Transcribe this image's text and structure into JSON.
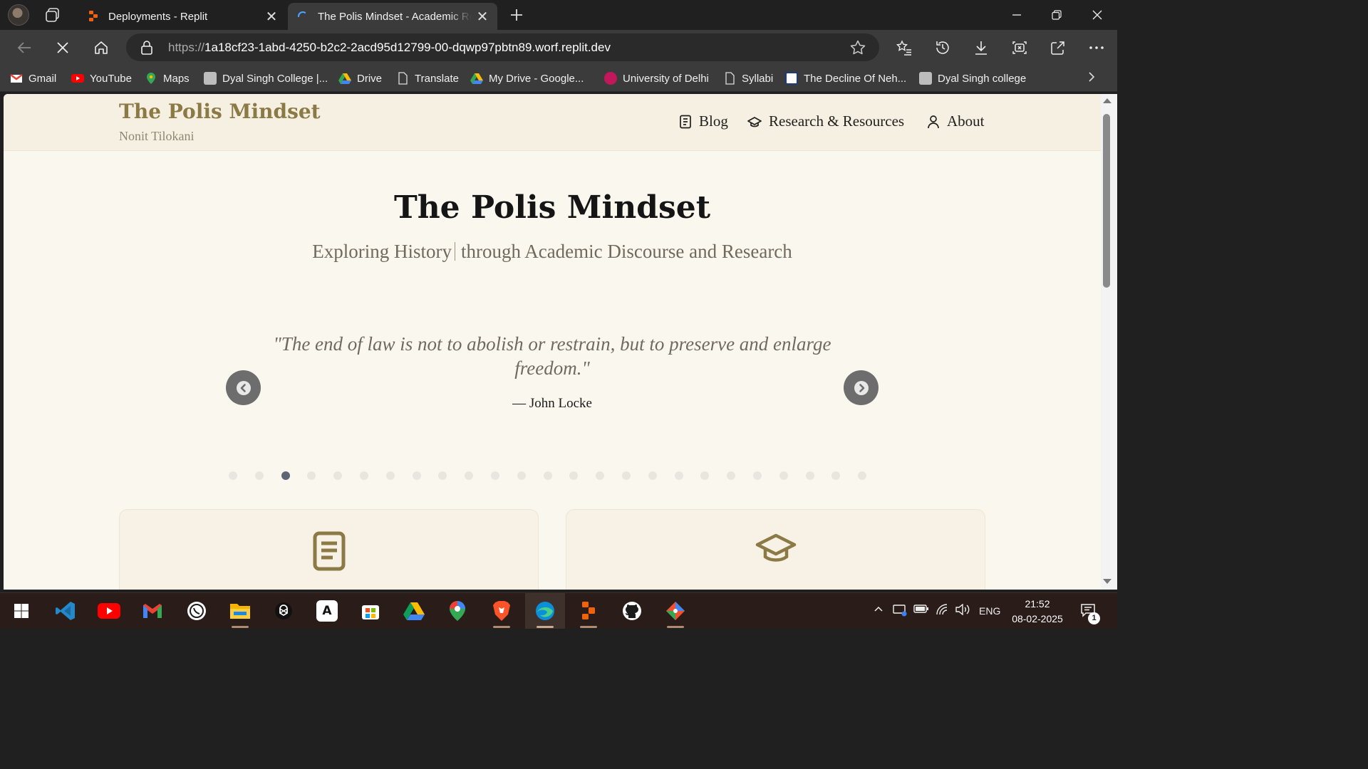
{
  "browser": {
    "tabs": [
      {
        "title": "Deployments - Replit"
      },
      {
        "title": "The Polis Mindset - Academic Research"
      }
    ],
    "url_protocol": "https://",
    "url_host": "1a18cf23-1abd-4250-b2c2-2acd95d12799-00-dqwp97pbtn89.worf.replit.dev",
    "bookmarks": [
      {
        "label": "Gmail",
        "icon": "gmail-icon",
        "color": "#ea4335"
      },
      {
        "label": "YouTube",
        "icon": "youtube-icon",
        "color": "#ff0000"
      },
      {
        "label": "Maps",
        "icon": "maps-icon",
        "color": "#34a853"
      },
      {
        "label": "Dyal Singh College |...",
        "icon": "college-icon",
        "color": "#9e9e9e"
      },
      {
        "label": "Drive",
        "icon": "drive-icon",
        "color": "#fbbc04"
      },
      {
        "label": "Translate",
        "icon": "page-icon",
        "color": "#dddddd"
      },
      {
        "label": "My Drive - Google...",
        "icon": "drive-icon",
        "color": "#fbbc04"
      },
      {
        "label": "University of Delhi",
        "icon": "du-icon",
        "color": "#c2185b"
      },
      {
        "label": "Syllabi",
        "icon": "page-icon",
        "color": "#dddddd"
      },
      {
        "label": "The Decline Of Neh...",
        "icon": "site-icon",
        "color": "#1a3c7a"
      },
      {
        "label": "Dyal Singh college",
        "icon": "college-icon",
        "color": "#9e9e9e"
      }
    ]
  },
  "site": {
    "brand": "The Polis Mindset",
    "author": "Nonit Tilokani",
    "nav": [
      {
        "label": "Blog",
        "icon": "book-icon"
      },
      {
        "label": "Research & Resources",
        "icon": "graduation-cap-icon"
      },
      {
        "label": "About",
        "icon": "user-icon"
      }
    ],
    "hero_title": "The Polis Mindset",
    "hero_sub_part1": "Exploring History",
    "hero_sub_part2": "through Academic Discourse and Research",
    "quote_text": "\"The end of law is not to abolish or restrain, but to preserve and enlarge freedom.\"",
    "quote_author": "— John Locke",
    "carousel_total": 25,
    "carousel_active_index": 2,
    "accent_color": "#8b7a45",
    "cards": [
      {
        "icon": "book-icon"
      },
      {
        "icon": "graduation-cap-icon"
      }
    ]
  },
  "taskbar": {
    "apps": [
      "windows-start-icon",
      "vscode-icon",
      "youtube-icon",
      "gmail-icon",
      "whatsapp-icon",
      "file-explorer-icon",
      "chatgpt-icon",
      "anthropic-icon",
      "microsoft-store-icon",
      "google-drive-icon",
      "google-maps-icon",
      "brave-icon",
      "edge-icon",
      "replit-icon",
      "github-icon",
      "git-icon"
    ],
    "language": "ENG",
    "time": "21:52",
    "date": "08-02-2025",
    "notification_count": "1"
  }
}
